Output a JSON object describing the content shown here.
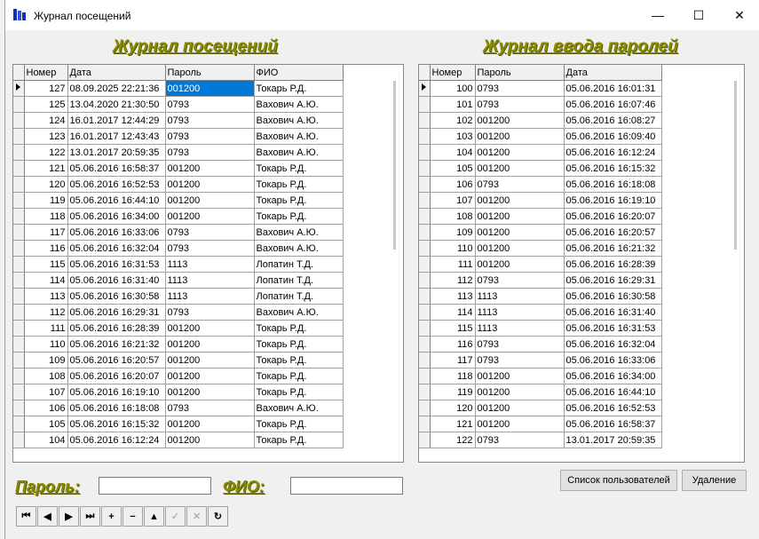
{
  "window": {
    "title": "Журнал посещений",
    "minimize": "—",
    "maximize": "☐",
    "close": "✕"
  },
  "left": {
    "heading": "Журнал посещений",
    "columns": [
      "Номер",
      "Дата",
      "Пароль",
      "ФИО"
    ],
    "rows": [
      [
        "127",
        "08.09.2025 22:21:36",
        "001200",
        "Токарь Р.Д."
      ],
      [
        "125",
        "13.04.2020 21:30:50",
        "0793",
        "Вахович А.Ю."
      ],
      [
        "124",
        "16.01.2017 12:44:29",
        "0793",
        "Вахович А.Ю."
      ],
      [
        "123",
        "16.01.2017 12:43:43",
        "0793",
        "Вахович А.Ю."
      ],
      [
        "122",
        "13.01.2017 20:59:35",
        "0793",
        "Вахович А.Ю."
      ],
      [
        "121",
        "05.06.2016 16:58:37",
        "001200",
        "Токарь Р.Д."
      ],
      [
        "120",
        "05.06.2016 16:52:53",
        "001200",
        "Токарь Р.Д."
      ],
      [
        "119",
        "05.06.2016 16:44:10",
        "001200",
        "Токарь Р.Д."
      ],
      [
        "118",
        "05.06.2016 16:34:00",
        "001200",
        "Токарь Р.Д."
      ],
      [
        "117",
        "05.06.2016 16:33:06",
        "0793",
        "Вахович А.Ю."
      ],
      [
        "116",
        "05.06.2016 16:32:04",
        "0793",
        "Вахович А.Ю."
      ],
      [
        "115",
        "05.06.2016 16:31:53",
        "1113",
        "Лопатин Т.Д."
      ],
      [
        "114",
        "05.06.2016 16:31:40",
        "1113",
        "Лопатин Т.Д."
      ],
      [
        "113",
        "05.06.2016 16:30:58",
        "1113",
        "Лопатин Т.Д."
      ],
      [
        "112",
        "05.06.2016 16:29:31",
        "0793",
        "Вахович А.Ю."
      ],
      [
        "111",
        "05.06.2016 16:28:39",
        "001200",
        "Токарь Р.Д."
      ],
      [
        "110",
        "05.06.2016 16:21:32",
        "001200",
        "Токарь Р.Д."
      ],
      [
        "109",
        "05.06.2016 16:20:57",
        "001200",
        "Токарь Р.Д."
      ],
      [
        "108",
        "05.06.2016 16:20:07",
        "001200",
        "Токарь Р.Д."
      ],
      [
        "107",
        "05.06.2016 16:19:10",
        "001200",
        "Токарь Р.Д."
      ],
      [
        "106",
        "05.06.2016 16:18:08",
        "0793",
        "Вахович А.Ю."
      ],
      [
        "105",
        "05.06.2016 16:15:32",
        "001200",
        "Токарь Р.Д."
      ],
      [
        "104",
        "05.06.2016 16:12:24",
        "001200",
        "Токарь Р.Д."
      ]
    ]
  },
  "right": {
    "heading": "Журнал ввода паролей",
    "columns": [
      "Номер",
      "Пароль",
      "Дата"
    ],
    "rows": [
      [
        "100",
        "0793",
        "05.06.2016 16:01:31"
      ],
      [
        "101",
        "0793",
        "05.06.2016 16:07:46"
      ],
      [
        "102",
        "001200",
        "05.06.2016 16:08:27"
      ],
      [
        "103",
        "001200",
        "05.06.2016 16:09:40"
      ],
      [
        "104",
        "001200",
        "05.06.2016 16:12:24"
      ],
      [
        "105",
        "001200",
        "05.06.2016 16:15:32"
      ],
      [
        "106",
        "0793",
        "05.06.2016 16:18:08"
      ],
      [
        "107",
        "001200",
        "05.06.2016 16:19:10"
      ],
      [
        "108",
        "001200",
        "05.06.2016 16:20:07"
      ],
      [
        "109",
        "001200",
        "05.06.2016 16:20:57"
      ],
      [
        "110",
        "001200",
        "05.06.2016 16:21:32"
      ],
      [
        "111",
        "001200",
        "05.06.2016 16:28:39"
      ],
      [
        "112",
        "0793",
        "05.06.2016 16:29:31"
      ],
      [
        "113",
        "1113",
        "05.06.2016 16:30:58"
      ],
      [
        "114",
        "1113",
        "05.06.2016 16:31:40"
      ],
      [
        "115",
        "1113",
        "05.06.2016 16:31:53"
      ],
      [
        "116",
        "0793",
        "05.06.2016 16:32:04"
      ],
      [
        "117",
        "0793",
        "05.06.2016 16:33:06"
      ],
      [
        "118",
        "001200",
        "05.06.2016 16:34:00"
      ],
      [
        "119",
        "001200",
        "05.06.2016 16:44:10"
      ],
      [
        "120",
        "001200",
        "05.06.2016 16:52:53"
      ],
      [
        "121",
        "001200",
        "05.06.2016 16:58:37"
      ],
      [
        "122",
        "0793",
        "13.01.2017 20:59:35"
      ]
    ]
  },
  "filters": {
    "password_label": "Пароль:",
    "password_value": "",
    "fio_label": "ФИО:",
    "fio_value": ""
  },
  "buttons": {
    "users": "Список пользователей",
    "delete": "Удаление"
  },
  "navigator": [
    {
      "name": "first-record-icon",
      "glyph": "⏮",
      "enabled": true
    },
    {
      "name": "prior-record-icon",
      "glyph": "◀",
      "enabled": true
    },
    {
      "name": "next-record-icon",
      "glyph": "▶",
      "enabled": true
    },
    {
      "name": "last-record-icon",
      "glyph": "⏭",
      "enabled": true
    },
    {
      "name": "insert-record-icon",
      "glyph": "+",
      "enabled": true
    },
    {
      "name": "delete-record-icon",
      "glyph": "−",
      "enabled": true
    },
    {
      "name": "edit-record-icon",
      "glyph": "▲",
      "enabled": true
    },
    {
      "name": "post-record-icon",
      "glyph": "✓",
      "enabled": false
    },
    {
      "name": "cancel-record-icon",
      "glyph": "✕",
      "enabled": false
    },
    {
      "name": "refresh-icon",
      "glyph": "↻",
      "enabled": true
    }
  ],
  "colors": {
    "heading": "#8a8a00",
    "selection": "#0078d7"
  }
}
